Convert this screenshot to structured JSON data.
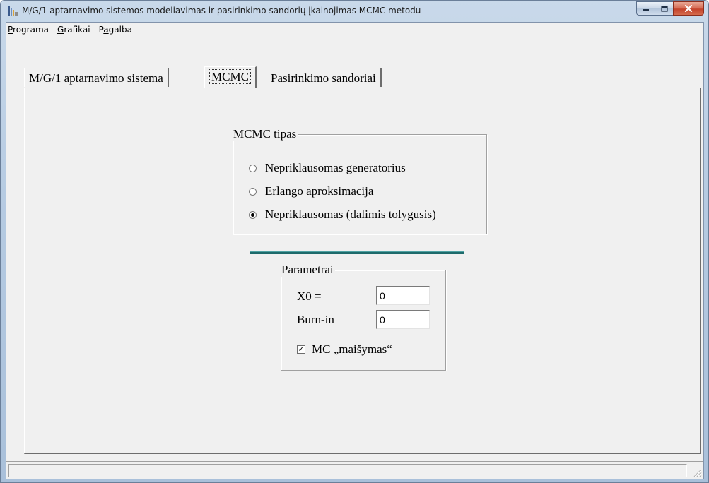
{
  "window": {
    "title": "M/G/1 aptarnavimo sistemos modeliavimas ir pasirinkimo sandorių įkainojimas MCMC metodu",
    "icon": "app-icon"
  },
  "menubar": {
    "items": [
      {
        "prefix": "",
        "accel": "P",
        "rest": "rograma"
      },
      {
        "prefix": "",
        "accel": "G",
        "rest": "rafikai"
      },
      {
        "prefix": "P",
        "accel": "a",
        "rest": "galba"
      }
    ]
  },
  "tabs": [
    {
      "label": "M/G/1 aptarnavimo sistema",
      "active": false
    },
    {
      "label": "MCMC",
      "active": true
    },
    {
      "label": "Pasirinkimo sandoriai",
      "active": false
    }
  ],
  "mcmc_type": {
    "legend": "MCMC tipas",
    "options": [
      {
        "label": "Nepriklausomas generatorius",
        "checked": false
      },
      {
        "label": "Erlango aproksimacija",
        "checked": false
      },
      {
        "label": "Nepriklausomas (dalimis tolygusis)",
        "checked": true
      }
    ]
  },
  "parameters": {
    "legend": "Parametrai",
    "x0_label": "X0 =",
    "x0_value": "0",
    "burnin_label": "Burn-in",
    "burnin_value": "0",
    "mc_mix_label": "MC „maišymas“",
    "mc_mix_checked": true
  },
  "colors": {
    "divider": "#1e6a6b",
    "close_button": "#c4432b"
  }
}
